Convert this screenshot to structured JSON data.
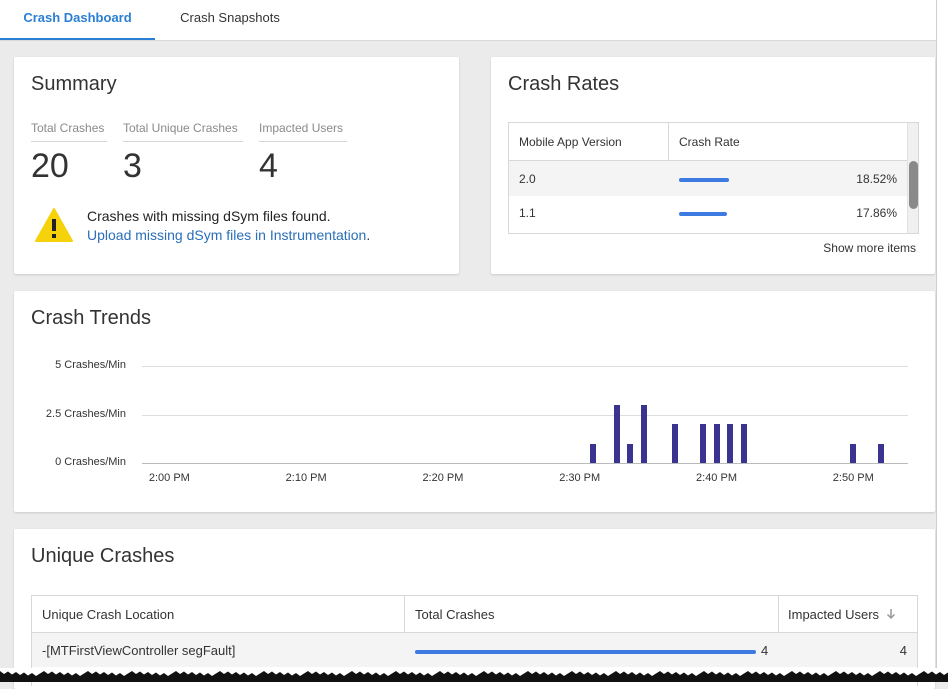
{
  "tabs": [
    {
      "label": "Crash Dashboard",
      "active": true
    },
    {
      "label": "Crash Snapshots",
      "active": false
    }
  ],
  "summary": {
    "title": "Summary",
    "stats": [
      {
        "label": "Total Crashes",
        "value": "20"
      },
      {
        "label": "Total Unique Crashes",
        "value": "3"
      },
      {
        "label": "Impacted Users",
        "value": "4"
      }
    ],
    "warning_text": "Crashes with missing dSym files found.",
    "warning_link": "Upload missing dSym files in Instrumentation",
    "warning_link_suffix": "."
  },
  "crash_rates": {
    "title": "Crash Rates",
    "columns": [
      "Mobile App Version",
      "Crash Rate"
    ],
    "rows": [
      {
        "version": "2.0",
        "rate": "18.52%",
        "fraction": 0.1852
      },
      {
        "version": "1.1",
        "rate": "17.86%",
        "fraction": 0.1786
      }
    ],
    "show_more": "Show more items"
  },
  "crash_trends": {
    "title": "Crash Trends"
  },
  "chart_data": {
    "type": "bar",
    "xlabel": "",
    "ylabel": "",
    "y_tick_labels": [
      "5 Crashes/Min",
      "2.5 Crashes/Min",
      "0 Crashes/Min"
    ],
    "y_ticks": [
      5,
      2.5,
      0
    ],
    "ylim": [
      0,
      5
    ],
    "x_tick_labels": [
      "2:00 PM",
      "2:10 PM",
      "2:20 PM",
      "2:30 PM",
      "2:40 PM",
      "2:50 PM"
    ],
    "x_ticks_min": [
      0,
      10,
      20,
      30,
      40,
      50
    ],
    "xlim_min": [
      -2,
      54
    ],
    "bar_color": "#3a3390",
    "grid": true,
    "series": [
      {
        "x_min": [
          31,
          32.7,
          33.7,
          34.7,
          37,
          39,
          40,
          41,
          42,
          50,
          52
        ],
        "values": [
          1,
          3,
          1,
          3,
          2,
          2,
          2,
          2,
          2,
          1,
          1
        ]
      }
    ]
  },
  "unique_crashes": {
    "title": "Unique Crashes",
    "columns": [
      "Unique Crash Location",
      "Total Crashes",
      "Impacted Users"
    ],
    "sort_icon": "arrow-down-icon",
    "rows": [
      {
        "location": "-[MTFirstViewController segFault]",
        "total": "4",
        "users": "4",
        "fraction": 1.0
      }
    ]
  },
  "colors": {
    "accent": "#2a7fd4",
    "bar": "#3d7be3",
    "chart": "#3a3390",
    "warning": "#f5d20c"
  }
}
